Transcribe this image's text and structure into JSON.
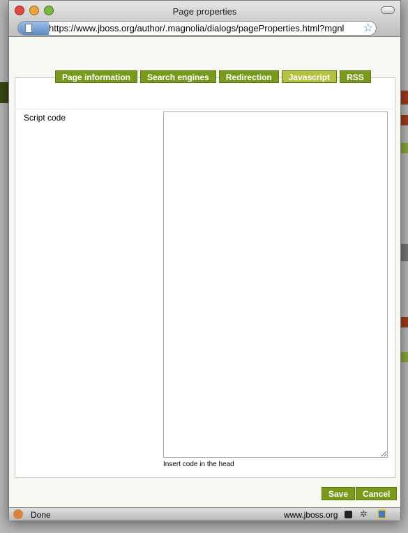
{
  "window": {
    "title": "Page properties",
    "url": "https://www.jboss.org/author/.magnolia/dialogs/pageProperties.html?mgnl"
  },
  "tabs": [
    {
      "label": "Page information"
    },
    {
      "label": "Search engines"
    },
    {
      "label": "Redirection"
    },
    {
      "label": "Javascript",
      "active": true
    },
    {
      "label": "RSS"
    }
  ],
  "form": {
    "script_label": "Script code",
    "script_value": "",
    "help": "Insert code in the head"
  },
  "buttons": {
    "save": "Save",
    "cancel": "Cancel"
  },
  "status": {
    "text": "Done",
    "domain": "www.jboss.org"
  },
  "colors": {
    "tab": "#7a9a1c",
    "tab_active": "#b4c240"
  }
}
